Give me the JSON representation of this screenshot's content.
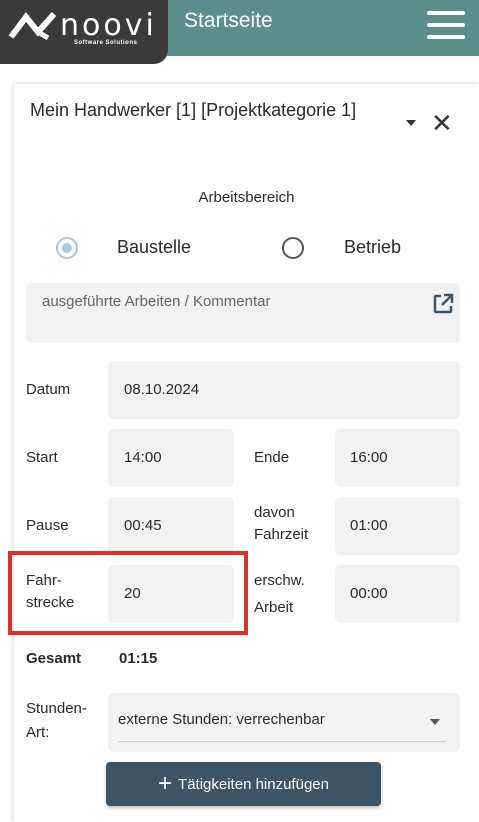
{
  "header": {
    "logo_text": "noovi",
    "logo_subtitle": "Software Solutions",
    "page_title": "Startseite",
    "colors": {
      "topbar": "#5b8f8c",
      "logo_bg": "#3a3a3a"
    }
  },
  "card": {
    "title": "Mein Handwerker [1] [Projektkategorie 1]",
    "section_label": "Arbeitsbereich",
    "radio_options": [
      {
        "label": "Baustelle",
        "checked": true
      },
      {
        "label": "Betrieb",
        "checked": false
      }
    ],
    "comment_placeholder": "ausgeführte Arbeiten / Kommentar",
    "fields": {
      "datum": {
        "label": "Datum",
        "value": "08.10.2024"
      },
      "start": {
        "label": "Start",
        "value": "14:00"
      },
      "ende": {
        "label": "Ende",
        "value": "16:00"
      },
      "pause": {
        "label": "Pause",
        "value": "00:45"
      },
      "fahrzeit": {
        "label_line1": "davon",
        "label_line2": "Fahrzeit",
        "value": "01:00"
      },
      "fahrstrecke": {
        "label_line1": "Fahr-",
        "label_line2": "strecke",
        "value": "20"
      },
      "erschwert": {
        "label_line1": "erschw.",
        "label_line2": "Arbeit",
        "value": "00:00"
      }
    },
    "gesamt": {
      "label": "Gesamt",
      "value": "01:15"
    },
    "stundenart": {
      "label_line1": "Stunden-",
      "label_line2": "Art:",
      "value": "externe Stunden: verrechenbar"
    },
    "add_button_label": "Tätigkeiten hinzufügen",
    "button_color": "#3d5566",
    "highlight_color": "#d9322b"
  }
}
